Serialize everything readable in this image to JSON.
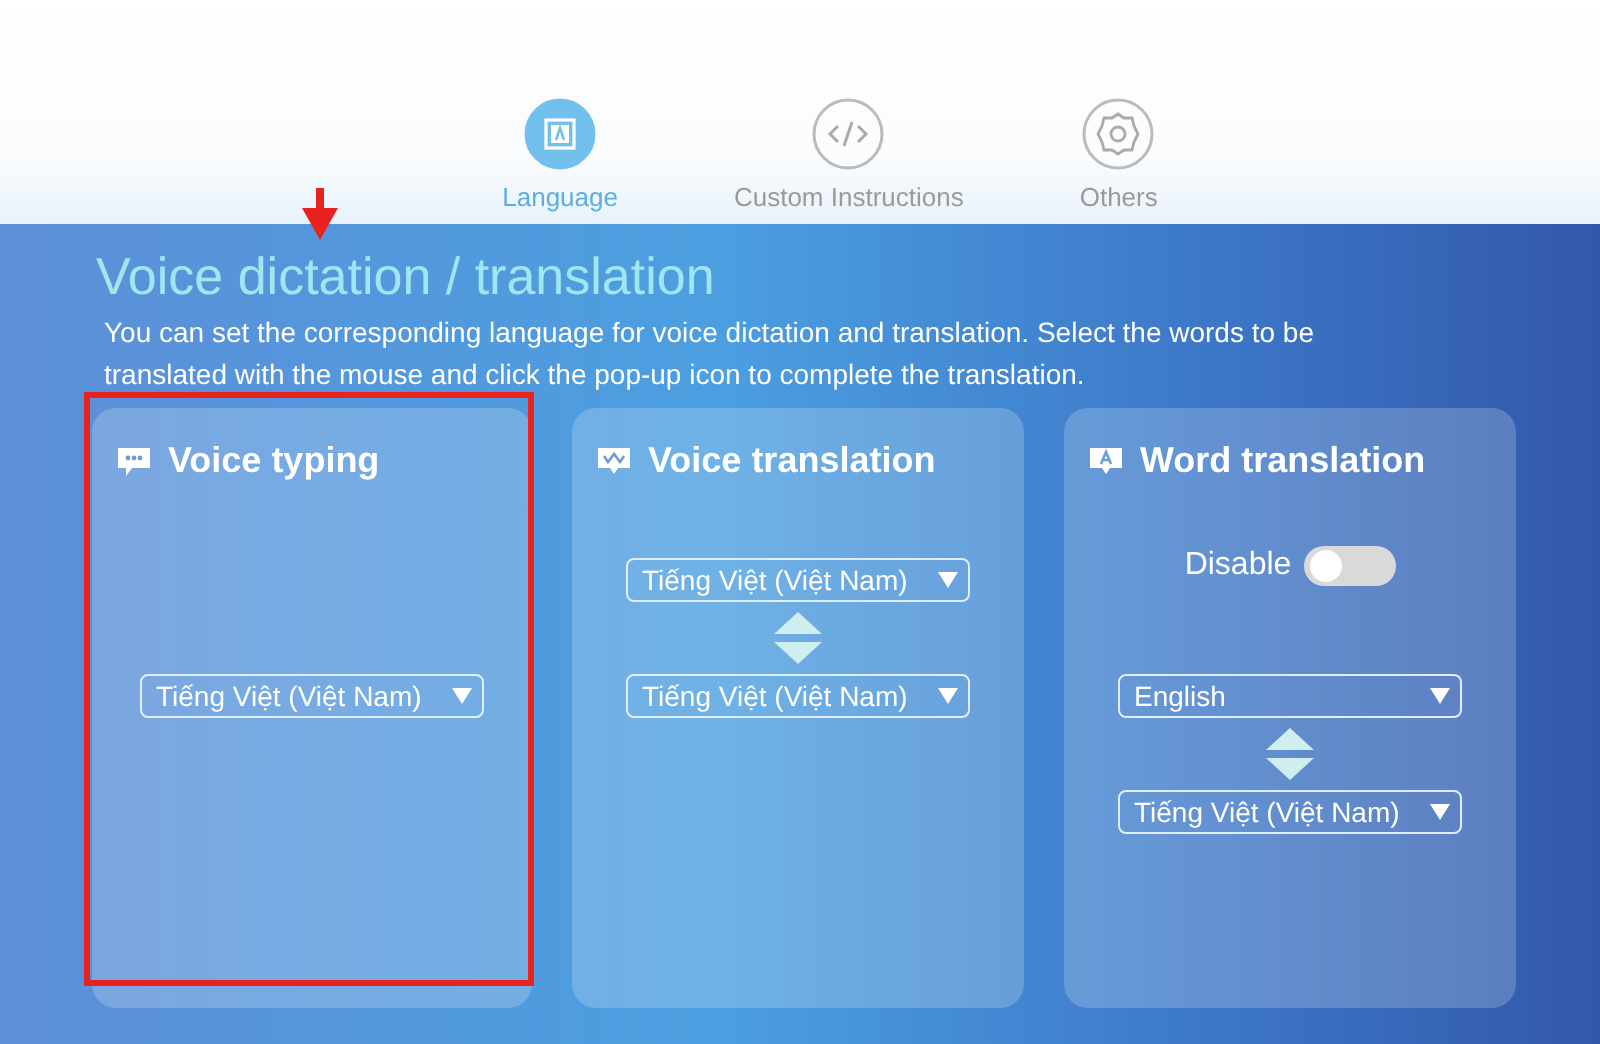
{
  "tabs": [
    {
      "label": "Language",
      "kind": "language",
      "selected": true
    },
    {
      "label": "Custom Instructions",
      "kind": "code",
      "selected": false
    },
    {
      "label": "Others",
      "kind": "settings",
      "selected": false
    }
  ],
  "section": {
    "title": "Voice dictation / translation",
    "description": "You can set the corresponding language for voice dictation and translation. Select the words to be translated with the mouse and click the pop-up icon to complete the translation."
  },
  "cards": [
    {
      "title": "Voice typing",
      "kind": "typing",
      "items": [
        {
          "kind": "select",
          "value": "Tiếng Việt (Việt Nam)"
        }
      ]
    },
    {
      "title": "Voice translation",
      "kind": "voice",
      "items": [
        {
          "kind": "select",
          "value": "Tiếng Việt (Việt Nam)"
        },
        {
          "kind": "swap"
        },
        {
          "kind": "select",
          "value": "Tiếng Việt (Việt Nam)"
        }
      ]
    },
    {
      "title": "Word translation",
      "kind": "word",
      "items": [
        {
          "kind": "toggle",
          "label": "Disable",
          "on": false
        },
        {
          "kind": "select",
          "value": "English"
        },
        {
          "kind": "swap"
        },
        {
          "kind": "select",
          "value": "Tiếng Việt (Việt Nam)"
        }
      ]
    }
  ]
}
